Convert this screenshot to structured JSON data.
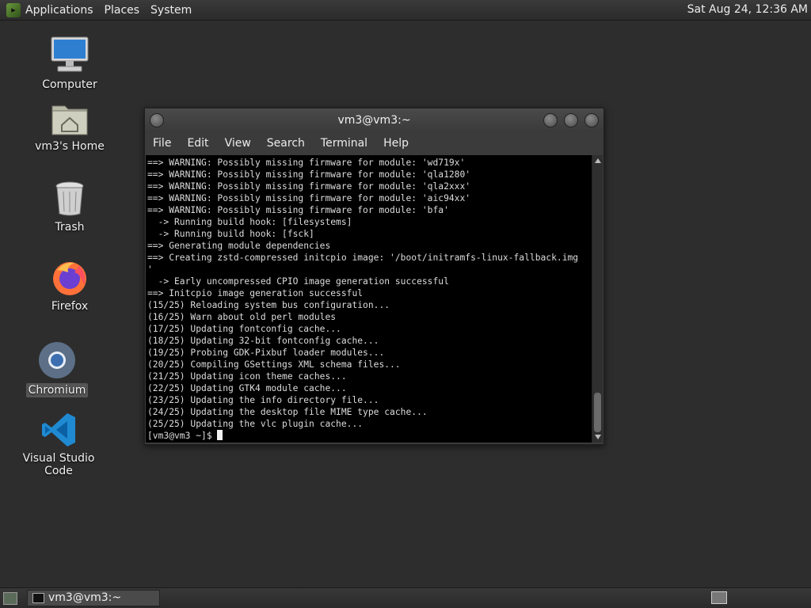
{
  "top_panel": {
    "menus": [
      "Applications",
      "Places",
      "System"
    ],
    "clock": "Sat Aug 24, 12:36 AM"
  },
  "desktop_icons": [
    {
      "label": "Computer",
      "icon": "computer-icon"
    },
    {
      "label": "vm3's Home",
      "icon": "home-folder-icon"
    },
    {
      "label": "Trash",
      "icon": "trash-icon"
    },
    {
      "label": "Firefox",
      "icon": "firefox-icon"
    },
    {
      "label": "Chromium",
      "icon": "chromium-icon"
    },
    {
      "label": "Visual Studio Code",
      "icon": "vscode-icon"
    }
  ],
  "terminal": {
    "title": "vm3@vm3:~",
    "menu": [
      "File",
      "Edit",
      "View",
      "Search",
      "Terminal",
      "Help"
    ],
    "lines": [
      "==> WARNING: Possibly missing firmware for module: 'wd719x'",
      "==> WARNING: Possibly missing firmware for module: 'qla1280'",
      "==> WARNING: Possibly missing firmware for module: 'qla2xxx'",
      "==> WARNING: Possibly missing firmware for module: 'aic94xx'",
      "==> WARNING: Possibly missing firmware for module: 'bfa'",
      "  -> Running build hook: [filesystems]",
      "  -> Running build hook: [fsck]",
      "==> Generating module dependencies",
      "==> Creating zstd-compressed initcpio image: '/boot/initramfs-linux-fallback.img",
      "'",
      "  -> Early uncompressed CPIO image generation successful",
      "==> Initcpio image generation successful",
      "(15/25) Reloading system bus configuration...",
      "(16/25) Warn about old perl modules",
      "(17/25) Updating fontconfig cache...",
      "(18/25) Updating 32-bit fontconfig cache...",
      "(19/25) Probing GDK-Pixbuf loader modules...",
      "(20/25) Compiling GSettings XML schema files...",
      "(21/25) Updating icon theme caches...",
      "(22/25) Updating GTK4 module cache...",
      "(23/25) Updating the info directory file...",
      "(24/25) Updating the desktop file MIME type cache...",
      "(25/25) Updating the vlc plugin cache..."
    ],
    "prompt": "[vm3@vm3 ~]$ "
  },
  "taskbar": {
    "task_label": "vm3@vm3:~"
  }
}
